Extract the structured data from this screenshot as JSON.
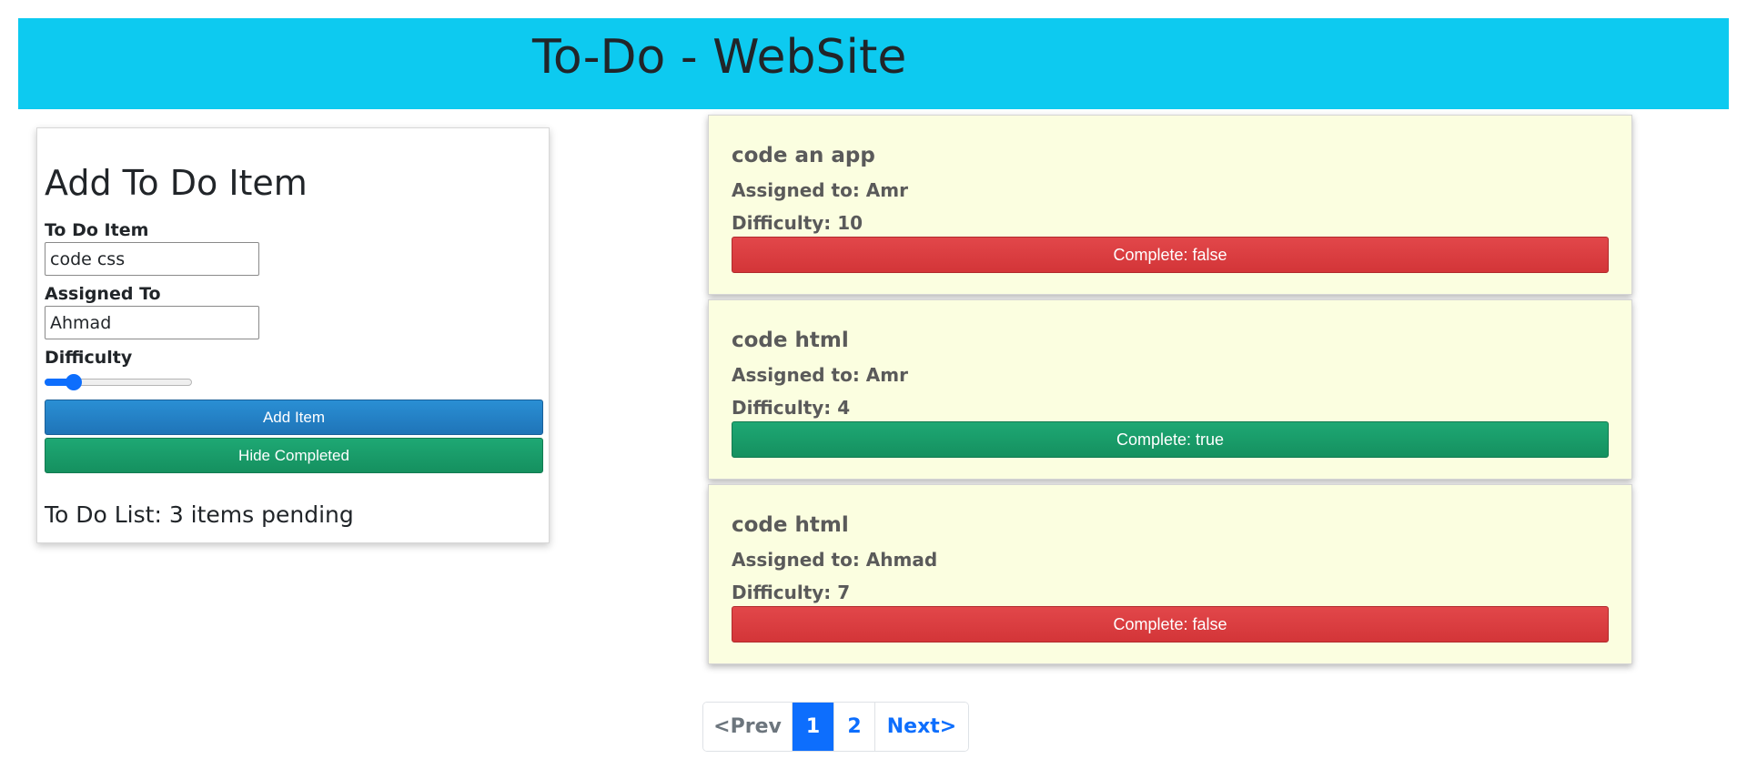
{
  "header": {
    "title": "To-Do - WebSite"
  },
  "form": {
    "title": "Add To Do Item",
    "item_label": "To Do Item",
    "item_value": "code css",
    "assigned_label": "Assigned To",
    "assigned_value": "Ahmad",
    "difficulty_label": "Difficulty",
    "difficulty_level": 0.2,
    "add_button": "Add Item",
    "hide_button": "Hide Completed",
    "pending_text": "To Do List: 3 items pending"
  },
  "items": [
    {
      "title": "code an app",
      "assigned": "Assigned to: Amr",
      "difficulty": "Difficulty: 10",
      "status": "Complete: false",
      "complete": false
    },
    {
      "title": "code html",
      "assigned": "Assigned to: Amr",
      "difficulty": "Difficulty: 4",
      "status": "Complete: true",
      "complete": true
    },
    {
      "title": "code html",
      "assigned": "Assigned to: Ahmad",
      "difficulty": "Difficulty: 7",
      "status": "Complete: false",
      "complete": false
    }
  ],
  "pagination": {
    "prev": "<Prev",
    "pages": [
      "1",
      "2"
    ],
    "active_page": "1",
    "next": "Next>"
  },
  "colors": {
    "header_bg": "#0dcaf0",
    "card_bg": "#fbfee0",
    "danger": "#dc3545",
    "success": "#198754",
    "primary": "#0d6efd"
  }
}
